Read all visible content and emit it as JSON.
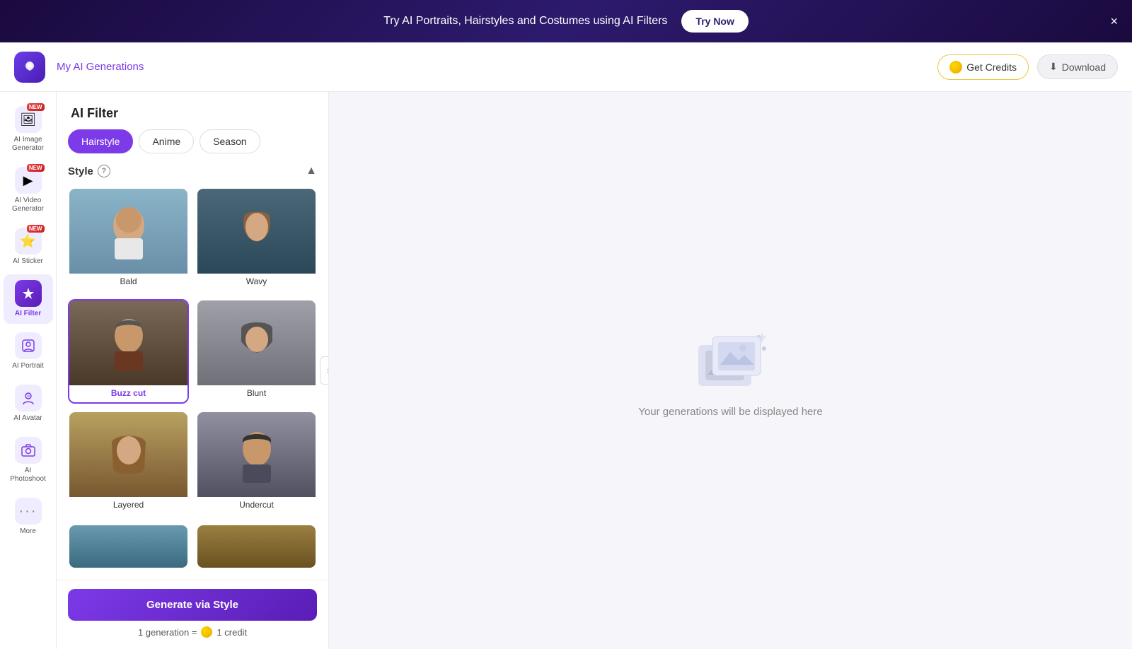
{
  "banner": {
    "text": "Try AI Portraits, Hairstyles and Costumes using AI Filters",
    "try_button": "Try Now",
    "close_label": "×"
  },
  "header": {
    "title": "My AI Generations",
    "get_credits_label": "Get Credits",
    "download_label": "Download"
  },
  "sidebar": {
    "items": [
      {
        "id": "ai-image-generator",
        "label": "AI Image\nGenerator",
        "icon": "🖼",
        "new": true,
        "active": false
      },
      {
        "id": "ai-video-generator",
        "label": "AI Video\nGenerator",
        "icon": "▶",
        "new": true,
        "active": false
      },
      {
        "id": "ai-sticker",
        "label": "AI Sticker",
        "icon": "⭐",
        "new": true,
        "active": false
      },
      {
        "id": "ai-filter",
        "label": "AI Filter",
        "icon": "✦",
        "new": false,
        "active": true
      },
      {
        "id": "ai-portrait",
        "label": "AI Portrait",
        "icon": "👤",
        "new": false,
        "active": false
      },
      {
        "id": "ai-avatar",
        "label": "AI Avatar",
        "icon": "😊",
        "new": false,
        "active": false
      },
      {
        "id": "ai-photoshoot",
        "label": "AI\nPhotoshoot",
        "icon": "📷",
        "new": false,
        "active": false
      },
      {
        "id": "more",
        "label": "More",
        "icon": "...",
        "new": false,
        "active": false
      }
    ]
  },
  "filter_panel": {
    "title": "AI Filter",
    "tabs": [
      {
        "id": "hairstyle",
        "label": "Hairstyle",
        "active": true
      },
      {
        "id": "anime",
        "label": "Anime",
        "active": false
      },
      {
        "id": "season",
        "label": "Season",
        "active": false
      }
    ],
    "style_section": {
      "label": "Style",
      "help_tooltip": "?",
      "cards": [
        {
          "id": "bald",
          "label": "Bald",
          "selected": false,
          "color_class": "bald-card"
        },
        {
          "id": "wavy",
          "label": "Wavy",
          "selected": false,
          "color_class": "wavy-card"
        },
        {
          "id": "buzz-cut",
          "label": "Buzz cut",
          "selected": true,
          "color_class": "buzzcut-card"
        },
        {
          "id": "blunt",
          "label": "Blunt",
          "selected": false,
          "color_class": "blunt-card"
        },
        {
          "id": "layered",
          "label": "Layered",
          "selected": false,
          "color_class": "layered-card"
        },
        {
          "id": "undercut",
          "label": "Undercut",
          "selected": false,
          "color_class": "undercut-card"
        }
      ]
    },
    "generate_button": "Generate via Style",
    "credit_info": {
      "prefix": "1 generation =",
      "amount": "1 credit"
    }
  },
  "content": {
    "empty_text": "Your generations will be displayed here"
  }
}
